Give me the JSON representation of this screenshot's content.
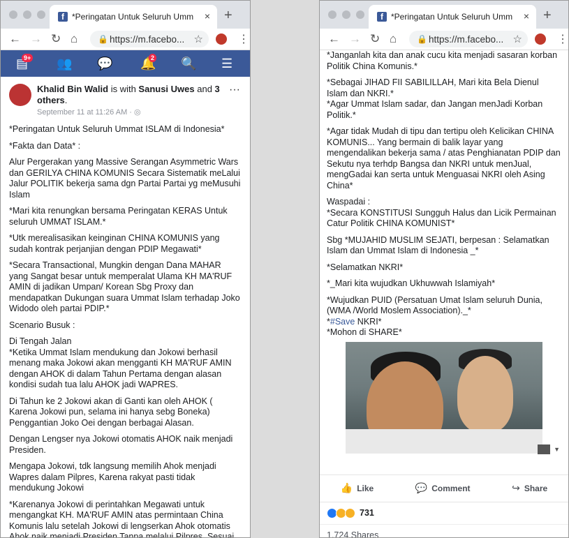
{
  "browser": {
    "tab_title": "*Peringatan Untuk Seluruh Umm",
    "new_tab": "+",
    "tab_close": "×",
    "url": "https://m.facebo..."
  },
  "fb": {
    "friend_requests_badge": "9+",
    "notifications_badge": "2"
  },
  "post": {
    "author": "Khalid Bin Walid",
    "with_text": " is with ",
    "tagged": "Sanusi Uwes",
    "and_text": " and ",
    "others": "3 others",
    "date": "September 11 at 11:26 AM · ",
    "more": "···"
  },
  "left_paragraphs": [
    "*Peringatan Untuk Seluruh Ummat ISLAM di Indonesia*",
    "*Fakta dan Data* :",
    "Alur Pergerakan yang Massive Serangan Asymmetric Wars dan GERILYA CHINA KOMUNIS Secara Sistematik meLalui Jalur POLITIK bekerja sama dgn Partai Partai yg meMusuhi Islam",
    "*Mari kita renungkan bersama Peringatan KERAS Untuk seluruh UMMAT ISLAM.*",
    "*Utk merealisasikan keinginan CHINA KOMUNIS yang sudah kontrak perjanjian dengan PDIP Megawati*",
    "*Secara Transactional, Mungkin dengan Dana MAHAR yang Sangat besar untuk memperalat Ulama KH MA'RUF AMIN di jadikan Umpan/ Korean Sbg Proxy dan mendapatkan Dukungan suara Ummat Islam terhadap Joko Widodo oleh partai PDIP.*",
    "Scenario Busuk :",
    "Di Tengah Jalan\n*Ketika Ummat Islam mendukung dan Jokowi berhasil menang maka Jokowi akan mengganti KH MA'RUF AMIN dengan AHOK di dalam Tahun Pertama dengan alasan kondisi sudah tua lalu AHOK jadi WAPRES.",
    "Di Tahun ke 2 Jokowi akan di Ganti kan oleh AHOK ( Karena Jokowi pun, selama ini hanya sebg Boneka)\nPenggantian Joko Oei dengan berbagai Alasan.",
    "Dengan Lengser nya Jokowi otomatis AHOK naik menjadi Presiden.",
    "Mengapa Jokowi, tdk langsung memilih Ahok menjadi Wapres dalam Pilpres, Karena rakyat pasti tidak mendukung Jokowi",
    "*Karenanya Jokowi di perintahkan Megawati untuk mengangkat KH. MA'RUF AMIN atas permintaan China Komunis lalu setelah Jokowi di lengserkan Ahok otomatis Ahok naik menjadi Presiden Tanpa melalui Pilpres, Sesuai UU, jika Presiden berHalangan Tetap."
  ],
  "right_paragraphs": [
    "*Janganlah kita dan anak cucu kita menjadi sasaran korban Politik China Komunis.*",
    "*Sebagai JIHAD FII SABILILLAH, Mari kita Bela Dienul Islam dan NKRI.*\n*Agar Ummat Islam sadar, dan Jangan menJadi Korban Politik.*",
    "*Agar tidak Mudah di tipu dan tertipu oleh Kelicikan CHINA KOMUNIS... Yang bermain di balik layar yang mengendalikan bekerja sama / atas Penghianatan PDIP dan Sekutu nya terhdp Bangsa dan NKRI untuk menJual, mengGadai kan serta untuk Menguasai NKRI oleh Asing China*",
    "Waspadai :\n*Secara KONSTITUSI Sungguh Halus dan Licik Permainan Catur Politik CHINA KOMUNIST*",
    "Sbg *MUJAHID MUSLIM SEJATI, berpesan : Selamatkan Islam dan Ummat Islam di Indonesia _*",
    "*Selamatkan NKRI*",
    "*_Mari kita wujudkan Ukhuwwah Islamiyah*",
    "*Wujudkan PUID (Persatuan Umat Islam seluruh Dunia, (WMA /World Moslem Association)._*"
  ],
  "hashtag_line": {
    "prefix": "*",
    "tag": "#Save",
    "suffix": " NKRI*"
  },
  "share_line": "*Mohon di SHARE*",
  "actions": {
    "like": "Like",
    "comment": "Comment",
    "share": "Share"
  },
  "reactions_count": "731",
  "shares_text": "1,724 Shares",
  "colors": {
    "facebook_blue": "#3b5998",
    "badge_red": "#f02849",
    "link": "#385898"
  }
}
